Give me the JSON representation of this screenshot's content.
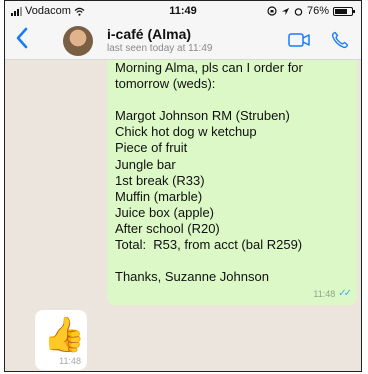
{
  "status_bar": {
    "carrier": "Vodacom",
    "time": "11:49",
    "battery": "76%",
    "battery_level": 0.76
  },
  "header": {
    "back_icon": "chevron-left-icon",
    "contact_name": "i-café (Alma)",
    "last_seen": "last seen today at 11:49",
    "video_icon": "video-call-icon",
    "call_icon": "phone-icon"
  },
  "messages": [
    {
      "direction": "outgoing",
      "lines": [
        "Morning Alma, pls can I order for",
        "tomorrow (weds):",
        "",
        "Margot Johnson RM (Struben)",
        "Chick hot dog w ketchup",
        "Piece of fruit",
        "Jungle bar",
        "1st break (R33)",
        "Muffin (marble)",
        "Juice box (apple)",
        "After school (R20)",
        "Total:  R53, from acct (bal R259)",
        "",
        "Thanks, Suzanne Johnson"
      ],
      "time": "11:48",
      "status_icon": "double-check-icon"
    },
    {
      "direction": "incoming",
      "emoji": "👍",
      "time": "11:48"
    }
  ],
  "colors": {
    "accent": "#1a7cf5",
    "outgoing_bubble": "#dcf8c6",
    "chat_background": "#ece5dd",
    "read_ticks": "#34b7f1"
  }
}
